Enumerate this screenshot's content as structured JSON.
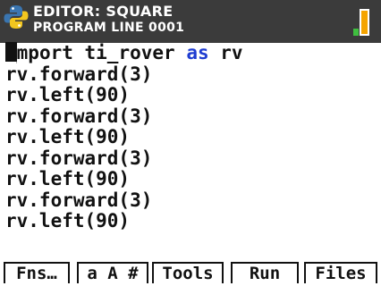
{
  "header": {
    "title": "EDITOR: SQUARE",
    "subtitle": "PROGRAM LINE 0001",
    "logo_icon": "python-logo-icon",
    "battery_icon": "battery-icon",
    "battery_color": "#f5a400",
    "battery_indicator_color": "#3fbf3f"
  },
  "code": {
    "lines": [
      {
        "cursor": "_",
        "rest_before_kw": "mport ti_rover ",
        "keyword": "as",
        "rest_after_kw": " rv"
      },
      {
        "text": "rv.forward(3)"
      },
      {
        "text": "rv.left(90)"
      },
      {
        "text": "rv.forward(3)"
      },
      {
        "text": "rv.left(90)"
      },
      {
        "text": "rv.forward(3)"
      },
      {
        "text": "rv.left(90)"
      },
      {
        "text": "rv.forward(3)"
      },
      {
        "text": "rv.left(90)"
      }
    ],
    "keyword_color": "#1f3dd1"
  },
  "menu": {
    "fns": "Fns…",
    "chars": "a A #",
    "tools": "Tools",
    "run": "Run",
    "files": "Files"
  }
}
